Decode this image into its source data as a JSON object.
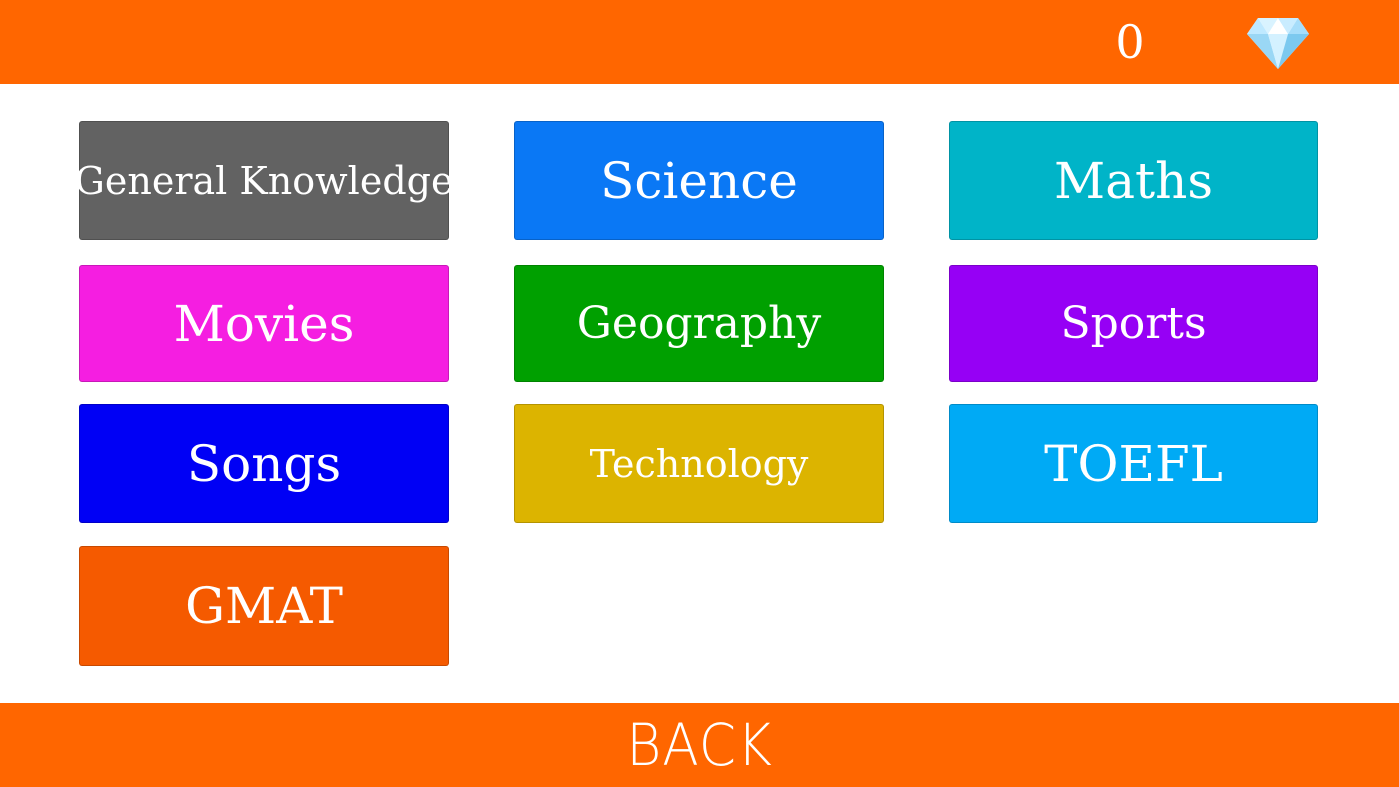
{
  "header": {
    "score": "0",
    "gem_icon": "diamond-icon",
    "background": "#ff6600"
  },
  "categories": [
    {
      "label": "General Knowledge",
      "color": "#626262"
    },
    {
      "label": "Science",
      "color": "#0a78f5"
    },
    {
      "label": "Maths",
      "color": "#00b4c8"
    },
    {
      "label": "Movies",
      "color": "#f51ee1"
    },
    {
      "label": "Geography",
      "color": "#00a000"
    },
    {
      "label": "Sports",
      "color": "#9600f5"
    },
    {
      "label": "Songs",
      "color": "#0000f5"
    },
    {
      "label": "Technology",
      "color": "#dcb400"
    },
    {
      "label": "TOEFL",
      "color": "#00aaf5"
    },
    {
      "label": "GMAT",
      "color": "#f55a00"
    }
  ],
  "footer": {
    "back_label": "BACK",
    "background": "#ff6600"
  }
}
